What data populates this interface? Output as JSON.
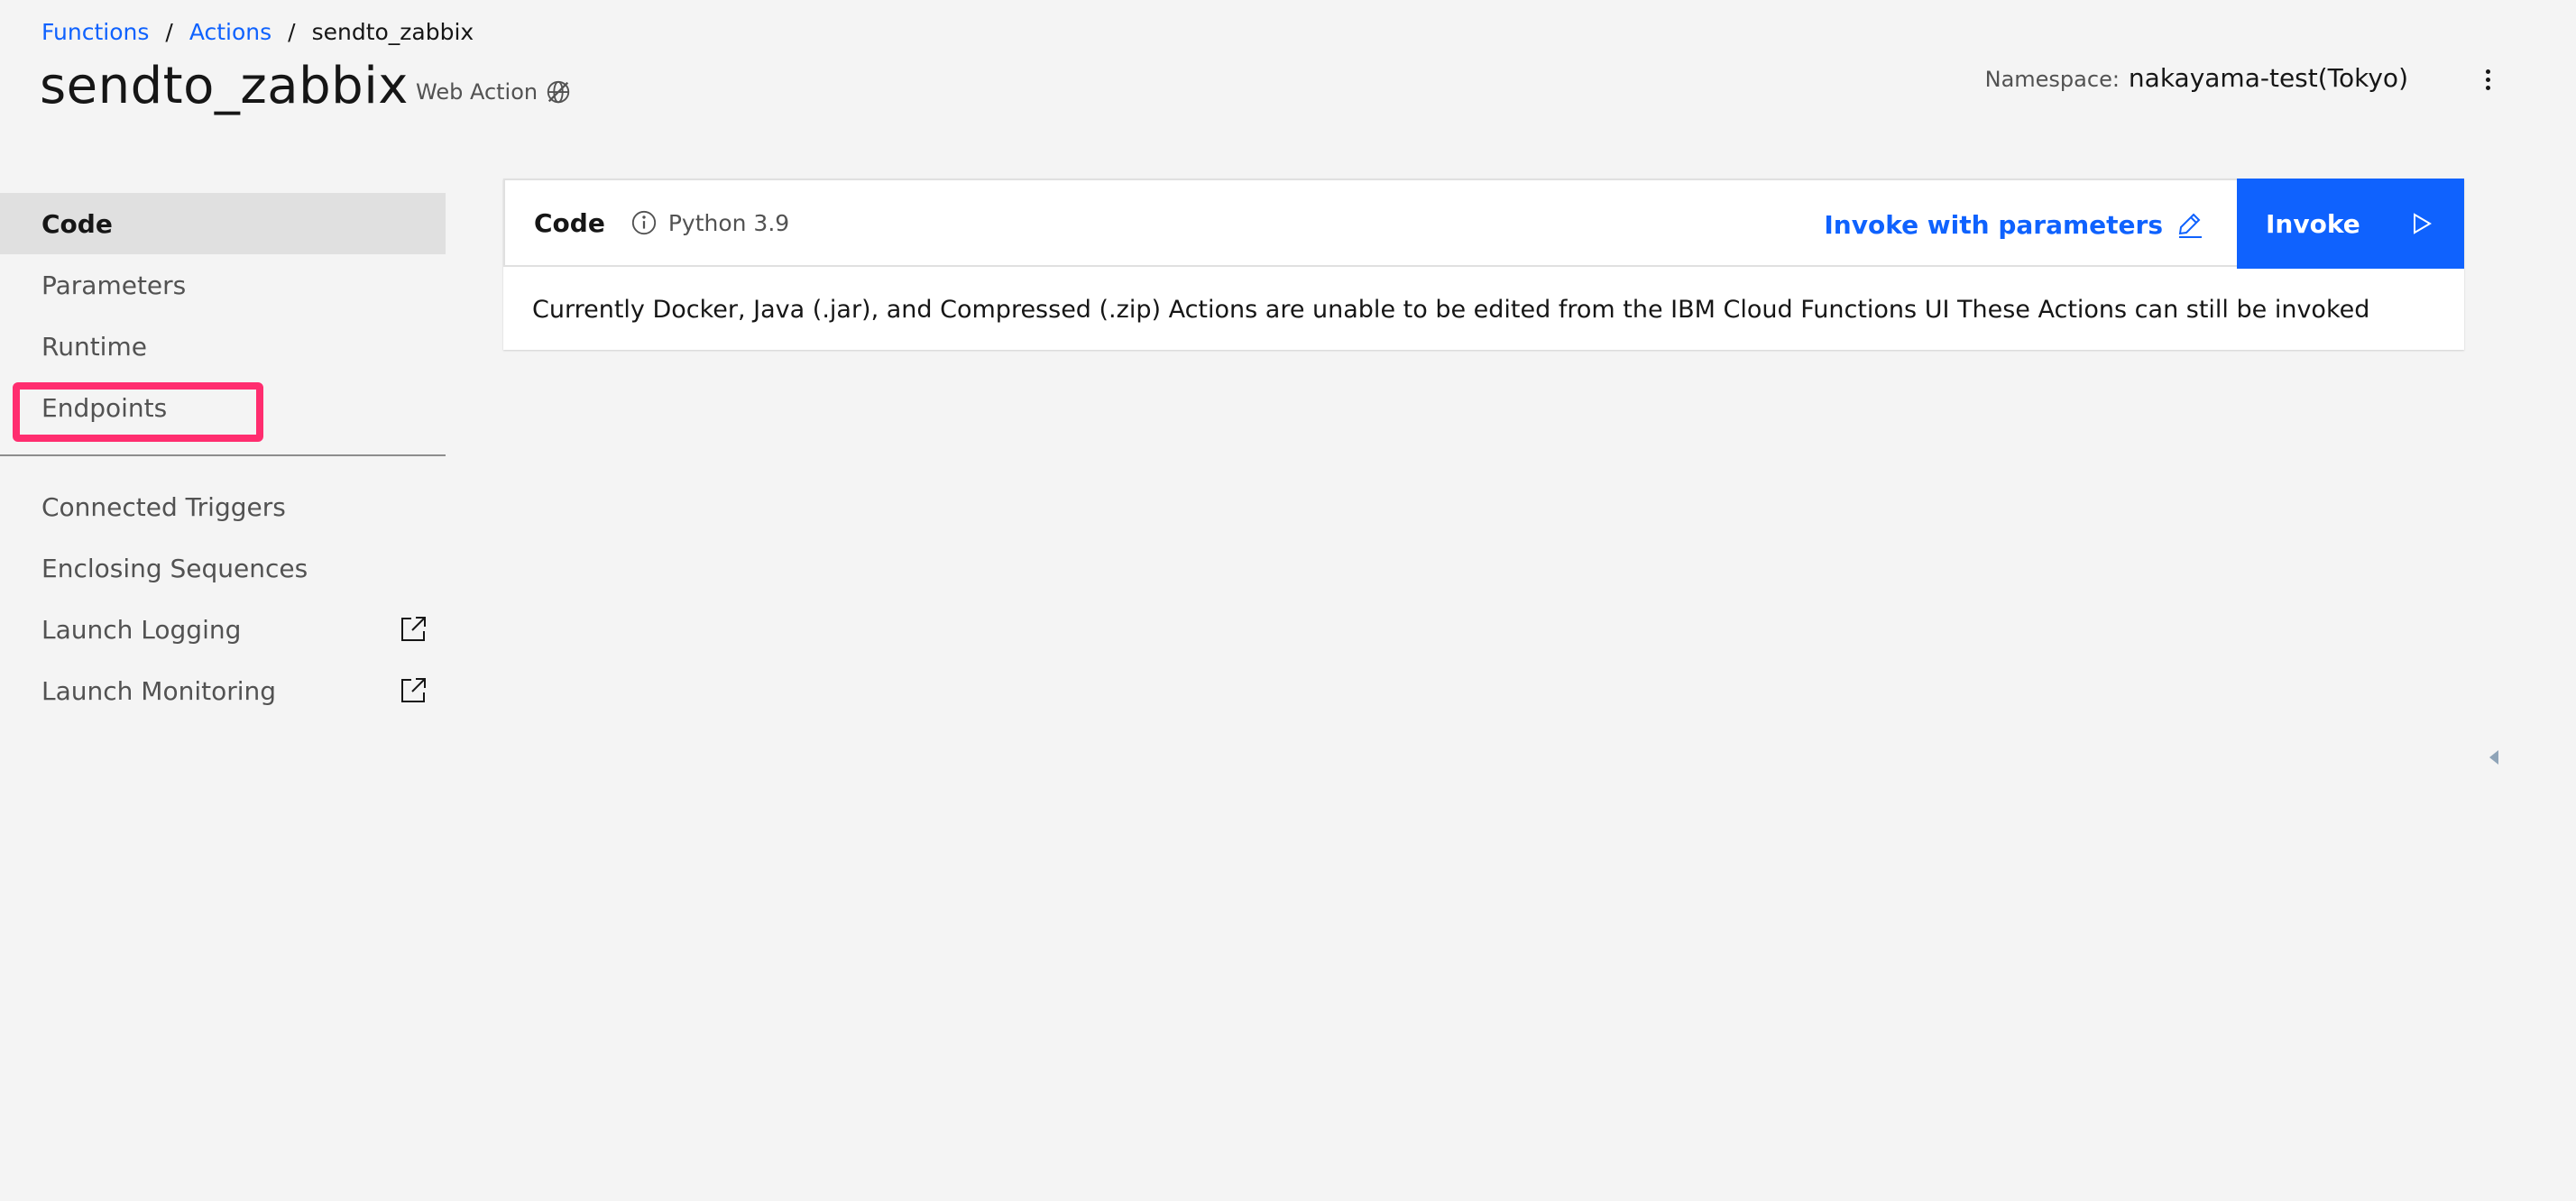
{
  "breadcrumb": {
    "items": [
      {
        "label": "Functions"
      },
      {
        "label": "Actions"
      }
    ],
    "separator": "/",
    "current": "sendto_zabbix"
  },
  "header": {
    "title": "sendto_zabbix",
    "web_action_label": "Web Action",
    "web_action_icon": "web-action-disabled-icon",
    "namespace_label": "Namespace:",
    "namespace_value": "nakayama-test(Tokyo)"
  },
  "sidebar": {
    "items": [
      {
        "label": "Code",
        "active": true
      },
      {
        "label": "Parameters"
      },
      {
        "label": "Runtime"
      },
      {
        "label": "Endpoints",
        "highlighted": true
      }
    ],
    "secondary_items": [
      {
        "label": "Connected Triggers"
      },
      {
        "label": "Enclosing Sequences"
      },
      {
        "label": "Launch Logging",
        "icon": "external-link-icon"
      },
      {
        "label": "Launch Monitoring",
        "icon": "external-link-icon"
      }
    ]
  },
  "code_panel": {
    "title": "Code",
    "runtime_icon": "info-icon",
    "runtime": "Python 3.9",
    "invoke_with_params_label": "Invoke with parameters",
    "invoke_with_params_icon": "edit-icon",
    "invoke_label": "Invoke",
    "invoke_icon": "play-icon",
    "message": "Currently Docker, Java (.jar), and Compressed (.zip) Actions are unable to be edited from the IBM Cloud Functions UI These Actions can still be invoked"
  },
  "colors": {
    "accent": "#0f62fe",
    "background": "#f4f4f4",
    "highlight": "#ff2d6f",
    "active_nav_bg": "#e0e0e0"
  }
}
